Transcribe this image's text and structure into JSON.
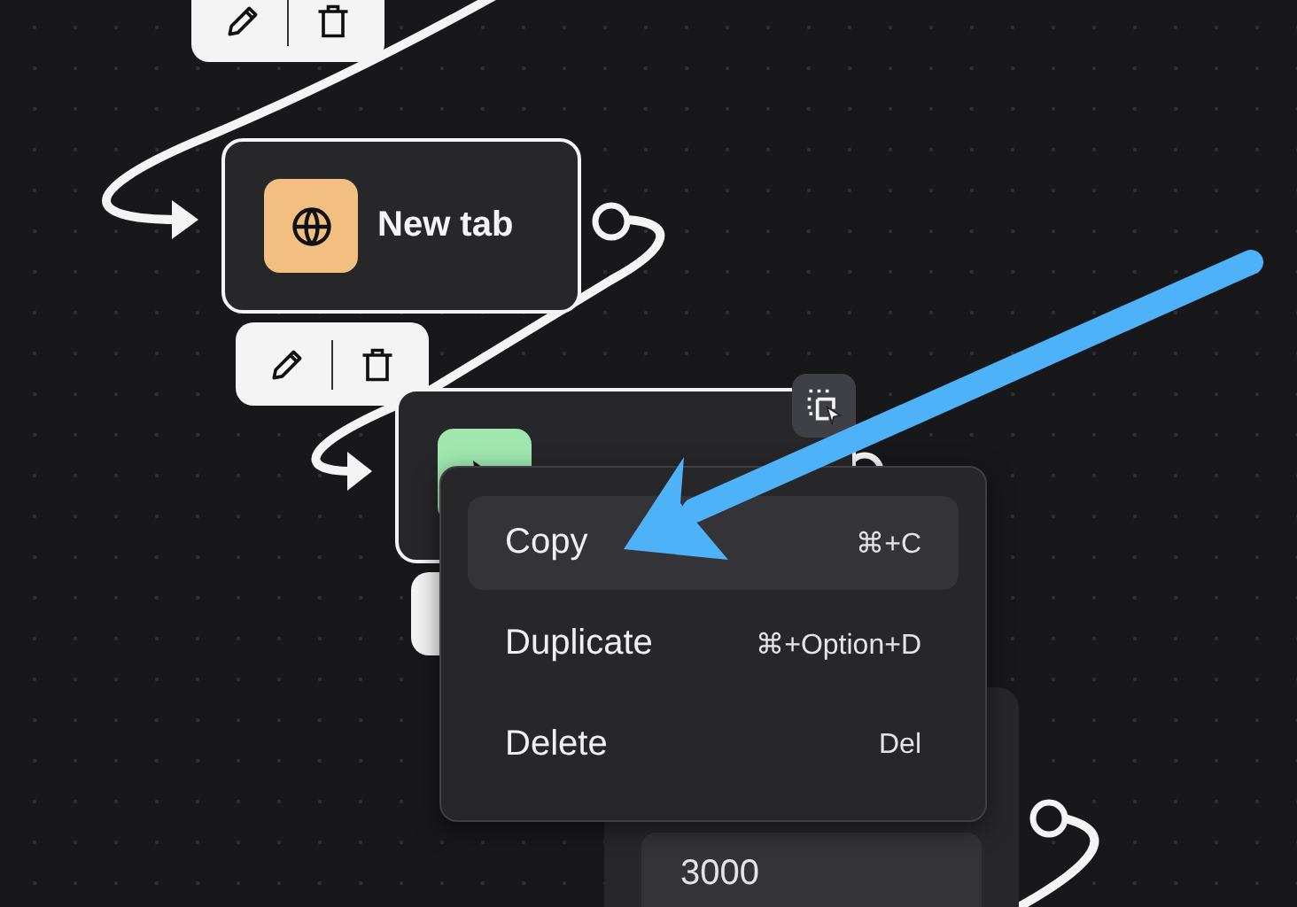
{
  "nodes": [
    {
      "kind": "navigate",
      "title": "New tab",
      "color": "#f2bf80",
      "border": true
    },
    {
      "kind": "click",
      "color": "#a0e8b0",
      "border": true
    },
    {
      "kind": "input",
      "value": "3000",
      "border": false
    }
  ],
  "context_menu": {
    "items": [
      {
        "label": "Copy",
        "shortcut": "⌘+C",
        "selected": true
      },
      {
        "label": "Duplicate",
        "shortcut": "⌘+Option+D",
        "selected": false
      },
      {
        "label": "Delete",
        "shortcut": "Del",
        "selected": false
      }
    ]
  }
}
